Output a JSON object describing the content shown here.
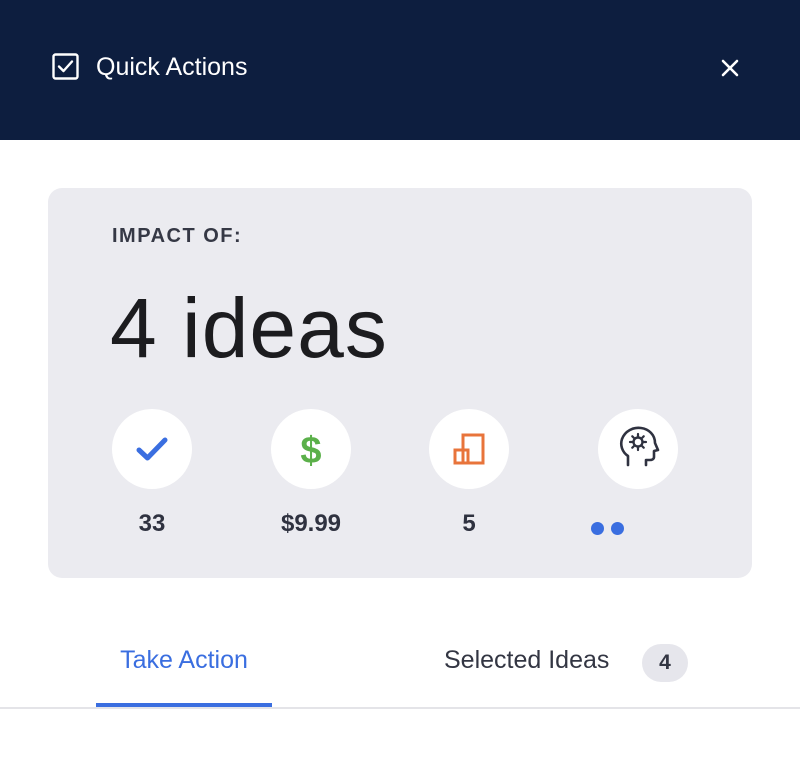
{
  "header": {
    "title": "Quick Actions",
    "check_icon": "checkbox-checked-icon",
    "close_icon": "close-icon"
  },
  "impact": {
    "label": "IMPACT OF:",
    "headline": "4 ideas",
    "metrics": [
      {
        "icon": "checkmark-icon",
        "value": "33",
        "color": "#3a6ee0"
      },
      {
        "icon": "dollar-icon",
        "value": "$9.99",
        "color": "#5bb04a"
      },
      {
        "icon": "squares-icon",
        "value": "5",
        "color": "#e8743b"
      },
      {
        "icon": "head-gear-icon",
        "value": "",
        "color": "#2f3240"
      }
    ]
  },
  "tabs": {
    "take_action": "Take Action",
    "selected_ideas": "Selected Ideas",
    "selected_count": "4"
  },
  "colors": {
    "header_bg": "#0d1e3f",
    "accent": "#3a6ee0",
    "card_bg": "#ebebf0"
  }
}
